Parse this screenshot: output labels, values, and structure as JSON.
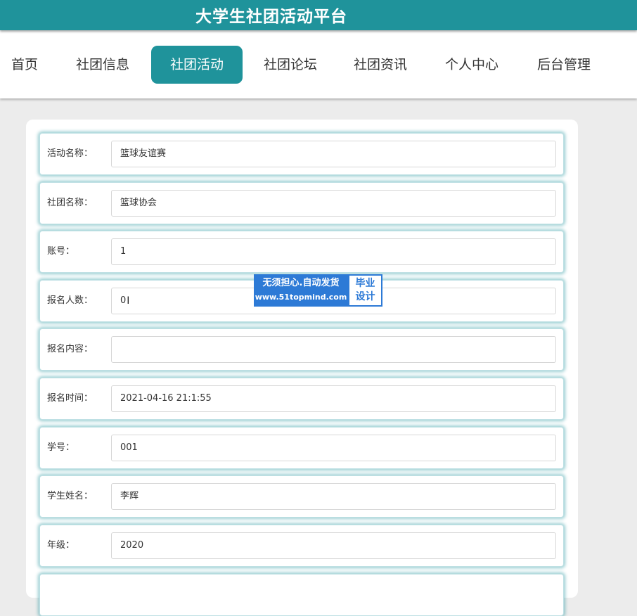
{
  "header": {
    "title": "大学生社团活动平台"
  },
  "nav": {
    "items": [
      {
        "label": "首页"
      },
      {
        "label": "社团信息"
      },
      {
        "label": "社团活动"
      },
      {
        "label": "社团论坛"
      },
      {
        "label": "社团资讯"
      },
      {
        "label": "个人中心"
      },
      {
        "label": "后台管理"
      }
    ],
    "active": "社团活动"
  },
  "form": {
    "fields": [
      {
        "label": "活动名称：",
        "value": "篮球友谊赛"
      },
      {
        "label": "社团名称：",
        "value": "篮球协会"
      },
      {
        "label": "账号：",
        "value": "1"
      },
      {
        "label": "报名人数：",
        "value": "0"
      },
      {
        "label": "报名内容：",
        "value": ""
      },
      {
        "label": "报名时间：",
        "value": "2021-04-16 21:1:55"
      },
      {
        "label": "学号：",
        "value": "001"
      },
      {
        "label": "学生姓名：",
        "value": "李辉"
      },
      {
        "label": "年级：",
        "value": "2020"
      }
    ]
  },
  "watermark": {
    "line1": "无须担心.自动发货",
    "line2": "www.51topmind.com",
    "badge_line1": "毕业",
    "badge_line2": "设计"
  },
  "colors": {
    "accent": "#1f939b",
    "watermark_blue": "#2d7ad6"
  }
}
